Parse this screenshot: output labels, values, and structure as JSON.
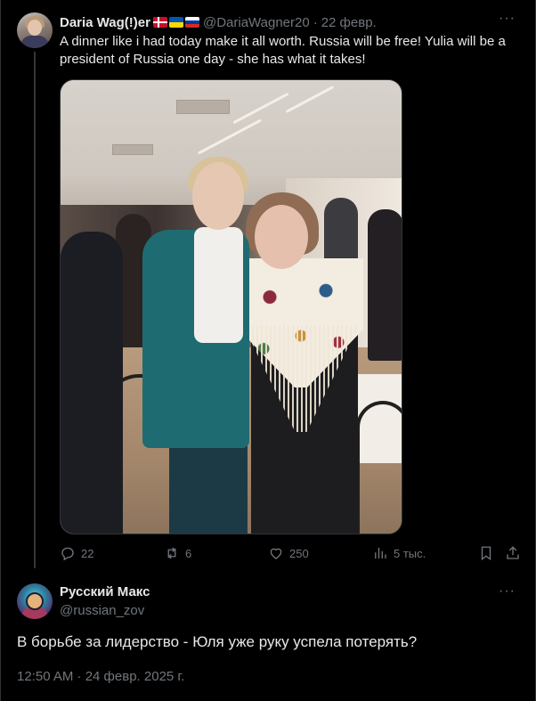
{
  "parent_tweet": {
    "author_name": "Daria Wag(!)er",
    "flags": [
      "denmark-flag",
      "ukraine-flag",
      "russia-flag"
    ],
    "handle": "@DariaWagner20",
    "separator": "·",
    "date": "22 февр.",
    "more_label": "···",
    "text": "A dinner like i had today make it all worth. Russia will be free! Yulia will be a president of Russia one day - she has what it takes!",
    "stats": {
      "replies": "22",
      "reposts": "6",
      "likes": "250",
      "views": "5 тыс."
    }
  },
  "reply_tweet": {
    "author_name": "Русский Макс",
    "handle": "@russian_zov",
    "more_label": "···",
    "text": "В борьбе за лидерство - Юля уже руку успела потерять?",
    "timestamp": "12:50 AM · 24 февр. 2025 г."
  },
  "colors": {
    "background": "#000000",
    "text_primary": "#e7e9ea",
    "text_secondary": "#71767b",
    "border": "#2f3336"
  }
}
